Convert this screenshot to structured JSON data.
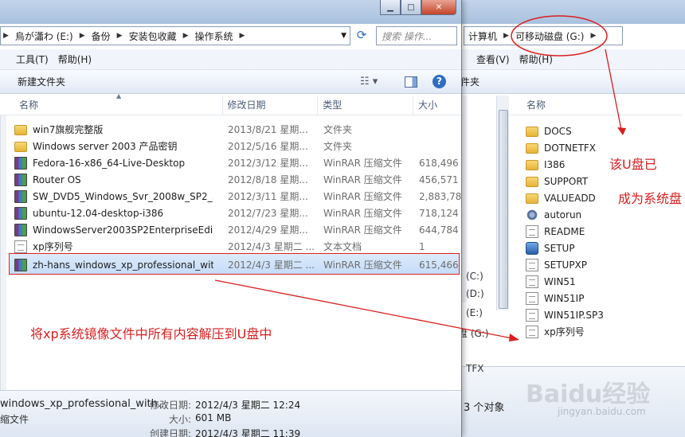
{
  "left_window": {
    "address_segments": [
      "烏が瀟わ (E:)",
      "备份",
      "安装包收藏",
      "操作系统"
    ],
    "search_placeholder": "搜索 操作...",
    "menu": [
      "工具(T)",
      "帮助(H)"
    ],
    "new_folder": "新建文件夹",
    "columns": {
      "name": "名称",
      "date": "修改日期",
      "type": "类型",
      "size": "大小"
    },
    "files": [
      {
        "name": "win7旗舰完整版",
        "date": "2013/8/21 星期...",
        "type": "文件夹",
        "size": "",
        "icon": "folder"
      },
      {
        "name": "Windows server 2003 产品密钥",
        "date": "2012/5/16 星期...",
        "type": "文件夹",
        "size": "",
        "icon": "folder"
      },
      {
        "name": "Fedora-16-x86_64-Live-Desktop",
        "date": "2012/3/12 星期...",
        "type": "WinRAR 压缩文件",
        "size": "618,496",
        "icon": "rar"
      },
      {
        "name": "Router OS",
        "date": "2012/8/18 星期...",
        "type": "WinRAR 压缩文件",
        "size": "456,571",
        "icon": "rar"
      },
      {
        "name": "SW_DVD5_Windows_Svr_2008w_SP2_...",
        "date": "2012/3/11 星期...",
        "type": "WinRAR 压缩文件",
        "size": "2,883,78",
        "icon": "rar"
      },
      {
        "name": "ubuntu-12.04-desktop-i386",
        "date": "2012/7/23 星期...",
        "type": "WinRAR 压缩文件",
        "size": "718,124",
        "icon": "rar"
      },
      {
        "name": "WindowsServer2003SP2EnterpriseEdi...",
        "date": "2012/4/29 星期...",
        "type": "WinRAR 压缩文件",
        "size": "644,784",
        "icon": "rar"
      },
      {
        "name": "xp序列号",
        "date": "2012/4/3 星期二 ...",
        "type": "文本文档",
        "size": "1",
        "icon": "txt"
      },
      {
        "name": "zh-hans_windows_xp_professional_wit...",
        "date": "2012/4/3 星期二 ...",
        "type": "WinRAR 压缩文件",
        "size": "615,466",
        "icon": "rar"
      }
    ],
    "details": {
      "filename": "windows_xp_professional_with...",
      "filetype": "缩文件",
      "modified_label": "修改日期:",
      "modified_value": "2012/4/3 星期二 12:24",
      "size_label": "大小:",
      "size_value": "601 MB",
      "created_label": "创建日期:",
      "created_value": "2012/4/3 星期二 11:39"
    }
  },
  "right_window": {
    "address_segments": [
      "计算机",
      "可移动磁盘 (G:)"
    ],
    "menu": [
      "查看(V)",
      "帮助(H)"
    ],
    "new_folder": "件夹",
    "column_name": "名称",
    "items": [
      {
        "name": "DOCS",
        "icon": "folder"
      },
      {
        "name": "DOTNETFX",
        "icon": "folder"
      },
      {
        "name": "I386",
        "icon": "folder"
      },
      {
        "name": "SUPPORT",
        "icon": "folder"
      },
      {
        "name": "VALUEADD",
        "icon": "folder"
      },
      {
        "name": "autorun",
        "icon": "gear"
      },
      {
        "name": "README",
        "icon": "txt"
      },
      {
        "name": "SETUP",
        "icon": "setup"
      },
      {
        "name": "SETUPXP",
        "icon": "txt"
      },
      {
        "name": "WIN51",
        "icon": "txt"
      },
      {
        "name": "WIN51IP",
        "icon": "txt"
      },
      {
        "name": "WIN51IP.SP3",
        "icon": "txt"
      },
      {
        "name": "xp序列号",
        "icon": "txt"
      }
    ],
    "drives": [
      "(C:)",
      "(D:)",
      "(E:)",
      "盘 (G:)",
      "TFX"
    ],
    "status": "3 个对象"
  },
  "annotations": {
    "note1_line1": "该U盘已",
    "note1_line2": "成为系统盘",
    "note2": "将xp系统镜像文件中所有内容解压到U盘中",
    "color": "#d91f1f"
  },
  "watermark": {
    "brand": "Baidu经验",
    "url": "jingyan.baidu.com"
  }
}
